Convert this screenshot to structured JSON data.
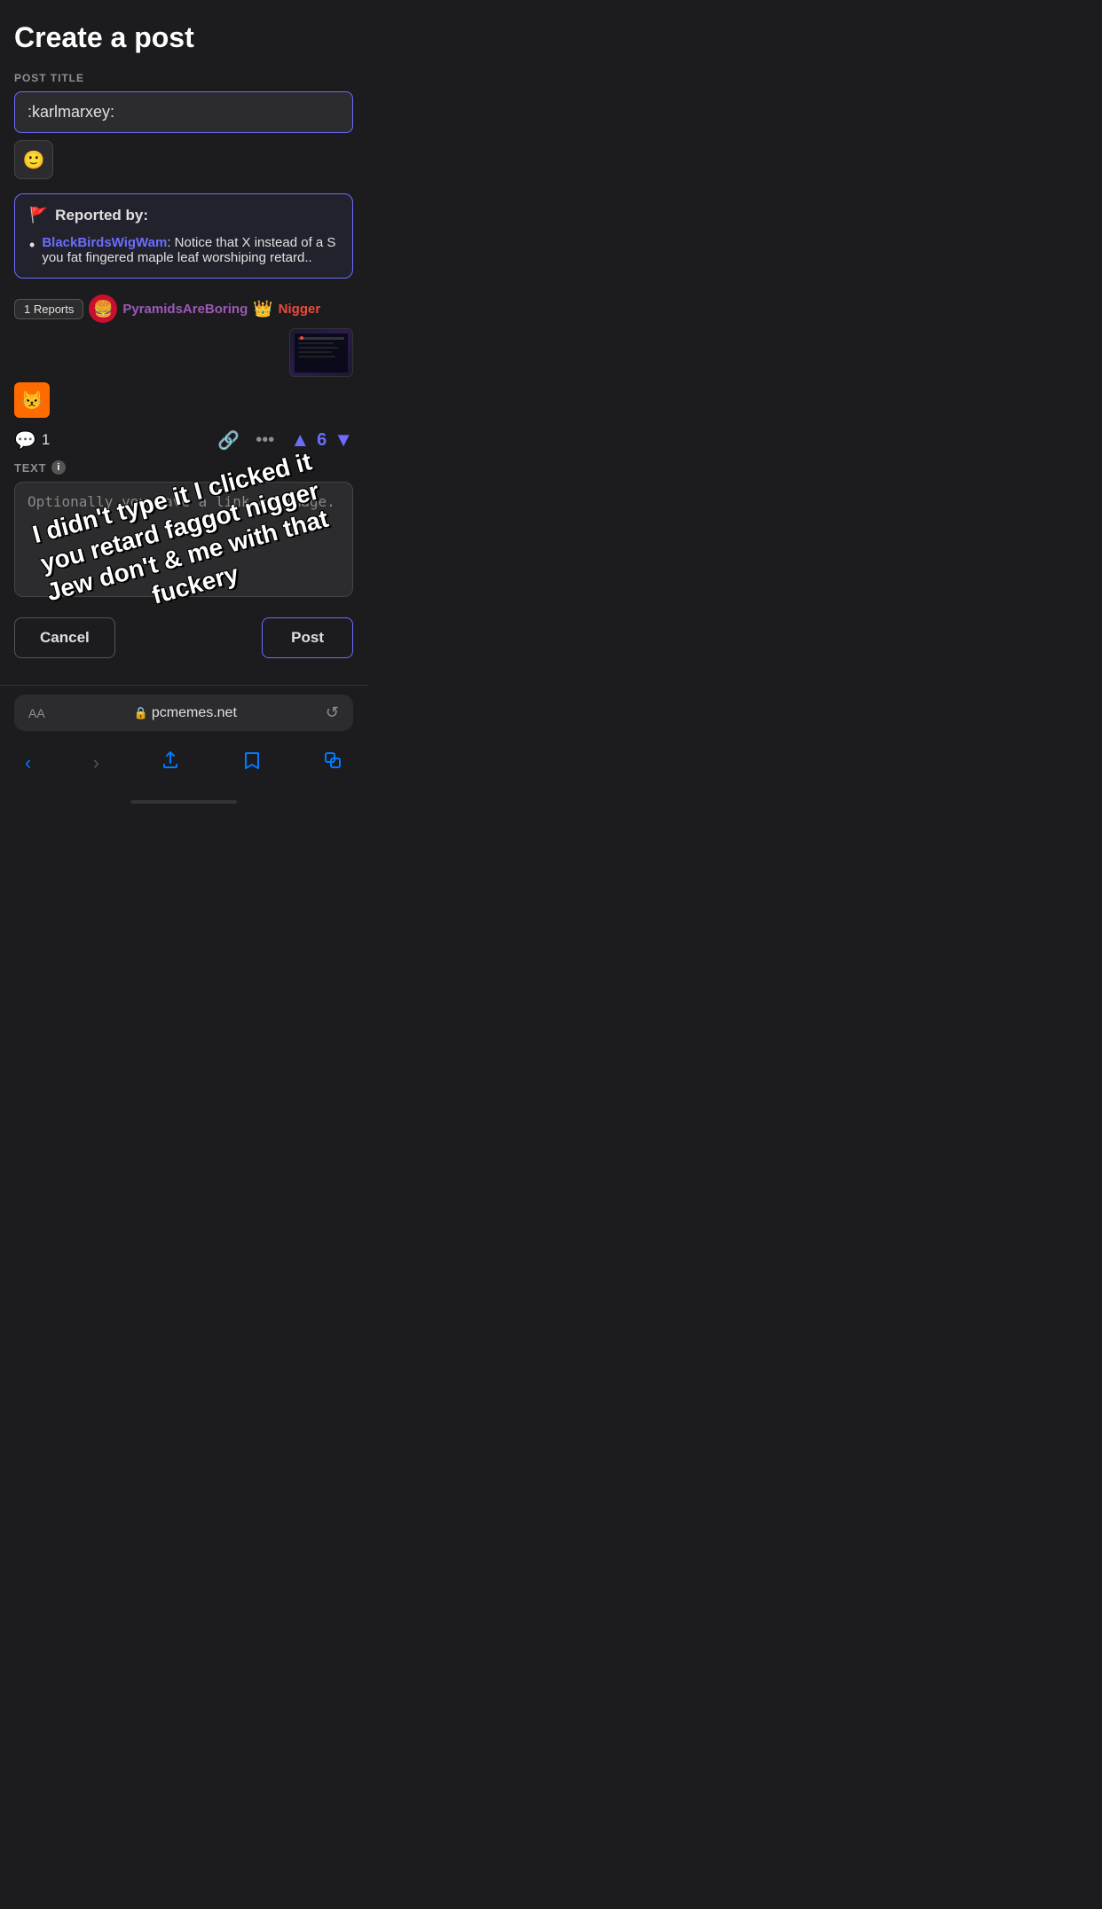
{
  "page": {
    "title": "Create a post",
    "post_title_label": "POST TITLE",
    "post_title_value": ":karlmarxey:",
    "emoji_button": "🙂",
    "reported_by_label": "Reported by:",
    "reporter_name": "BlackBirdsWigWam",
    "report_text": ": Notice that X instead of a S you fat fingered maple leaf worshiping retard..",
    "reports_badge": "1 Reports",
    "username_main": "PyramidsAreBoring",
    "username_red": "Nigger",
    "crown_emoji": "👑",
    "scratch_avatar": "😾",
    "comment_count": "1",
    "vote_count": "6",
    "text_label": "TEXT",
    "text_placeholder": "Optionally you have a link or image.",
    "overlaid_text": "I didn't type it I clicked it you retard faggot nigger Jew don't & me with that fuckery",
    "cancel_label": "Cancel",
    "post_label": "Post",
    "url_bar_aa": "AA",
    "url_domain": "pcmemes.net",
    "reports_section": "Reports"
  }
}
